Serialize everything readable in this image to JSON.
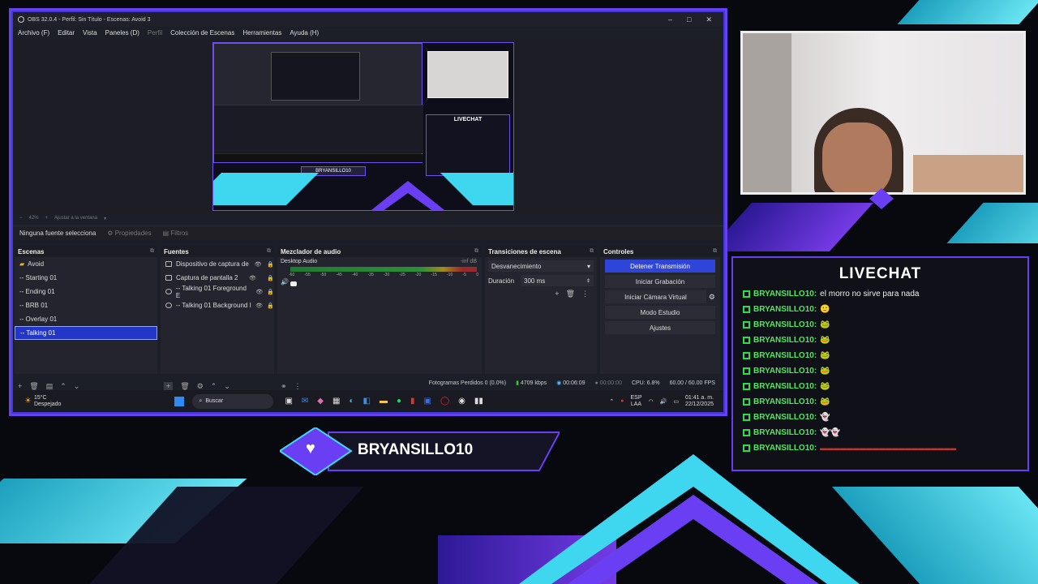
{
  "window": {
    "title": "OBS 32.0.4 - Perfil: Sin Título - Escenas: Avoid 3",
    "controls": [
      "–",
      "□",
      "✕"
    ]
  },
  "menu": [
    "Archivo (F)",
    "Editar",
    "Vista",
    "Paneles (D)",
    "Perfil",
    "Colección de Escenas",
    "Herramientas",
    "Ayuda (H)"
  ],
  "preview": {
    "zoom": "42%",
    "zoom_option": "Ajustar a la ventana",
    "inner_name": "BRYANSILLO10",
    "inner_chat_title": "LIVECHAT"
  },
  "source_toolbar": {
    "selection": "Ninguna fuente selecciona",
    "properties": "Propiedades",
    "filters": "Filtros"
  },
  "docks": {
    "scenes": {
      "title": "Escenas",
      "items": [
        "Avoid",
        "-- Starting 01",
        "-- Ending 01",
        "-- BRB 01",
        "-- Overlay 01",
        "-- Talking 01"
      ],
      "selected": "-- Talking 01"
    },
    "sources": {
      "title": "Fuentes",
      "items": [
        "Dispositivo de captura de",
        "Captura de pantalla 2",
        "-- Talking 01  Foreground E",
        "-- Talking 01  Background I"
      ]
    },
    "mixer": {
      "title": "Mezclador de audio",
      "channel": "Desktop Audio",
      "level": "-inf dB",
      "ticks": [
        "-60",
        "-55",
        "-50",
        "-45",
        "-40",
        "-35",
        "-30",
        "-25",
        "-20",
        "-15",
        "-10",
        "-5",
        "0"
      ]
    },
    "transitions": {
      "title": "Transiciones de escena",
      "selected": "Desvanecimiento",
      "duration_label": "Duración",
      "duration_value": "300 ms"
    },
    "controls": {
      "title": "Controles",
      "buttons": [
        "Detener Transmisión",
        "Iniciar Grabación",
        "Iniciar Cámara Virtual",
        "Modo Estudio",
        "Ajustes"
      ]
    }
  },
  "status": {
    "dropped": "Fotogramas Perdidos 0 (0.0%)",
    "bitrate": "4709 kbps",
    "stream_time": "00:06:09",
    "rec_time": "00:00:00",
    "cpu": "CPU: 6.8%",
    "fps": "60.00 / 60.00 FPS"
  },
  "taskbar": {
    "weather_temp": "15°C",
    "weather_desc": "Despejado",
    "search": "Buscar",
    "lang": "ESP",
    "layout": "LAA",
    "time": "01:41 a. m.",
    "date": "22/12/2025"
  },
  "banner": {
    "name": "BRYANSILLO10"
  },
  "chat": {
    "title": "LIVECHAT",
    "partial": "el morro no sirve para nada",
    "messages": [
      {
        "user": "BRYANSILLO10:",
        "text": "el morro no sirve para nada"
      },
      {
        "user": "BRYANSILLO10:",
        "text": "🙂"
      },
      {
        "user": "BRYANSILLO10:",
        "text": "🐸"
      },
      {
        "user": "BRYANSILLO10:",
        "text": "🐸"
      },
      {
        "user": "BRYANSILLO10:",
        "text": "🐸"
      },
      {
        "user": "BRYANSILLO10:",
        "text": "🐸"
      },
      {
        "user": "BRYANSILLO10:",
        "text": "🐸"
      },
      {
        "user": "BRYANSILLO10:",
        "text": "🐸"
      },
      {
        "user": "BRYANSILLO10:",
        "text": "👻"
      },
      {
        "user": "BRYANSILLO10:",
        "text": "👻👻"
      },
      {
        "user": "BRYANSILLO10:",
        "text": "▬▬▬▬▬▬▬▬▬▬▬▬▬▬▬▬▬▬▬▬▬"
      }
    ]
  },
  "colors": {
    "accent_purple": "#6a3ff3",
    "accent_cyan": "#3fd6f0",
    "obs_select": "#2237c9",
    "chat_green": "#4ee85f"
  }
}
